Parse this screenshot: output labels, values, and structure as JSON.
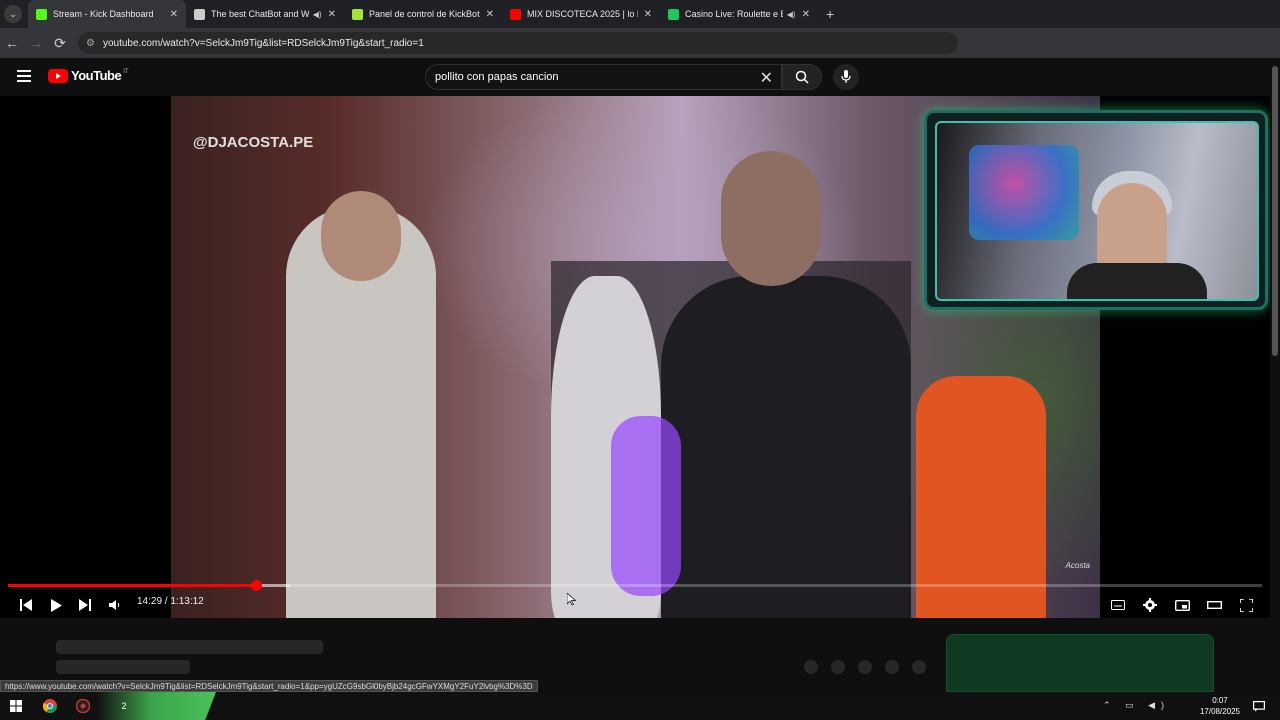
{
  "browser": {
    "tabs": [
      {
        "title": "Stream - Kick Dashboard",
        "favicon": "kick-icon",
        "color": "#53fc18",
        "active": true,
        "sound": false
      },
      {
        "title": "The best ChatBot and Widg",
        "favicon": "botrix-icon",
        "color": "#cccccc",
        "active": false,
        "sound": true
      },
      {
        "title": "Panel de control de KickBot",
        "favicon": "kickbot-icon",
        "color": "#a3e635",
        "active": false,
        "sound": false
      },
      {
        "title": "MIX DISCOTECA 2025 | lo MEJO",
        "favicon": "youtube-icon",
        "color": "#ff0000",
        "active": false,
        "sound": false
      },
      {
        "title": "Casino Live: Roulette e Blac",
        "favicon": "casino-icon",
        "color": "#22c55e",
        "active": false,
        "sound": true
      }
    ],
    "url": "youtube.com/watch?v=SelckJm9Tig&list=RDSelckJm9Tig&start_radio=1",
    "new_tab": "+"
  },
  "youtube": {
    "logo_text": "YouTube",
    "country_code": "IT",
    "search_value": "pollito con papas cancion",
    "clear_glyph": "✕"
  },
  "video": {
    "watermark": "@DJACOSTA.PE",
    "corner_watermark": "Acosta",
    "progress_played": 0.198,
    "progress_buffered": 0.225,
    "time_current": "14:29",
    "time_total": "1:13:12",
    "time_separator": " / "
  },
  "status_bar": {
    "url": "https://www.youtube.com/watch?v=SelckJm9Tig&list=RDSelckJm9Tig&start_radio=1&pp=ygUZcG9sbGl0byBjb24gcGFwYXMgY2FuY2lvbg%3D%3D"
  },
  "taskbar": {
    "time": "0:07",
    "date": "17/08/2025",
    "badge_count": "2"
  }
}
